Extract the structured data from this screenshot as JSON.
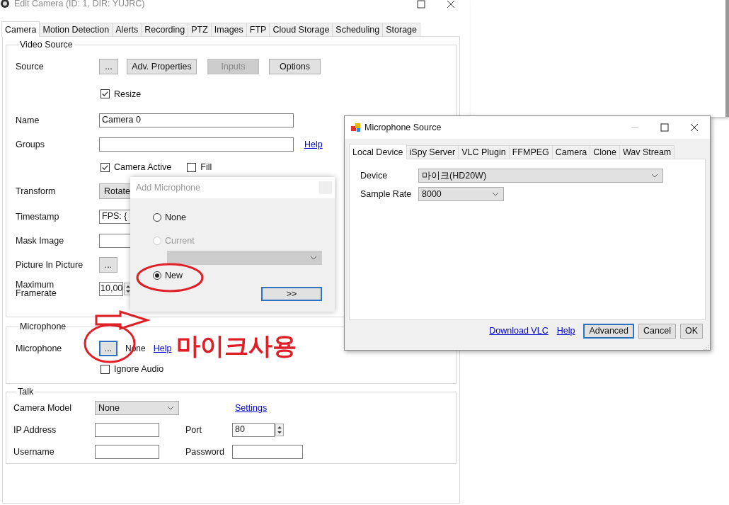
{
  "edit_camera": {
    "title": "Edit Camera (ID: 1, DIR: YUJRC)",
    "tabs": [
      {
        "label": "Camera",
        "selected": true
      },
      {
        "label": "Motion Detection",
        "selected": false
      },
      {
        "label": "Alerts",
        "selected": false
      },
      {
        "label": "Recording",
        "selected": false
      },
      {
        "label": "PTZ",
        "selected": false
      },
      {
        "label": "Images",
        "selected": false
      },
      {
        "label": "FTP",
        "selected": false
      },
      {
        "label": "Cloud Storage",
        "selected": false
      },
      {
        "label": "Scheduling",
        "selected": false
      },
      {
        "label": "Storage",
        "selected": false
      }
    ],
    "video_source": {
      "legend": "Video Source",
      "source_label": "Source",
      "source_buttons": [
        {
          "label": "...",
          "disabled": false
        },
        {
          "label": "Adv. Properties",
          "disabled": false
        },
        {
          "label": "Inputs",
          "disabled": true
        },
        {
          "label": "Options",
          "disabled": false
        }
      ],
      "resize": {
        "label": "Resize",
        "checked": true
      },
      "name": {
        "label": "Name",
        "value": "Camera 0"
      },
      "groups": {
        "label": "Groups",
        "link": "Help"
      },
      "camera_active": {
        "label": "Camera Active",
        "checked": true
      },
      "fill": {
        "label": "Fill",
        "checked": false
      },
      "transform": {
        "label": "Transform",
        "button": "Rotate"
      },
      "timestamp": {
        "label": "Timestamp",
        "value": "FPS: {"
      },
      "mask_image": {
        "label": "Mask Image"
      },
      "picture_in_picture": {
        "label": "Picture In Picture",
        "button": "..."
      },
      "maximum_framerate": {
        "label": "Maximum Framerate",
        "value": "10,00"
      }
    },
    "microphone": {
      "legend": "Microphone",
      "label": "Microphone",
      "button": "...",
      "button_focused": true,
      "value": "None",
      "link": "Help",
      "ignore_audio": {
        "label": "Ignore Audio",
        "checked": false
      }
    },
    "talk": {
      "legend": "Talk",
      "camera_model": {
        "label": "Camera Model",
        "value": "None"
      },
      "settings_link": "Settings",
      "ip_address": {
        "label": "IP Address"
      },
      "port": {
        "label": "Port",
        "value": "80"
      },
      "username": {
        "label": "Username"
      },
      "password": {
        "label": "Password"
      }
    }
  },
  "add_microphone": {
    "title": "Add Microphone",
    "options": [
      {
        "label": "None",
        "kind": "radio",
        "selected": false,
        "disabled": false
      },
      {
        "label": "Current",
        "kind": "radio-dropdown",
        "selected": false,
        "disabled": true
      },
      {
        "label": "New",
        "kind": "radio",
        "selected": true,
        "disabled": false
      }
    ],
    "next_button": ">>"
  },
  "microphone_source": {
    "title": "Microphone Source",
    "tabs": [
      {
        "label": "Local Device",
        "selected": true
      },
      {
        "label": "iSpy Server",
        "selected": false
      },
      {
        "label": "VLC Plugin",
        "selected": false
      },
      {
        "label": "FFMPEG",
        "selected": false
      },
      {
        "label": "Camera",
        "selected": false
      },
      {
        "label": "Clone",
        "selected": false
      },
      {
        "label": "Wav Stream",
        "selected": false
      }
    ],
    "device": {
      "label": "Device",
      "value": "마이크(HD20W)"
    },
    "sample_rate": {
      "label": "Sample Rate",
      "value": "8000"
    },
    "links": [
      "Download VLC",
      "Help"
    ],
    "buttons": [
      {
        "label": "Advanced",
        "focused": true
      },
      {
        "label": "Cancel",
        "focused": false
      },
      {
        "label": "OK",
        "focused": false
      }
    ]
  },
  "annotation": {
    "text": "마이크사용"
  }
}
